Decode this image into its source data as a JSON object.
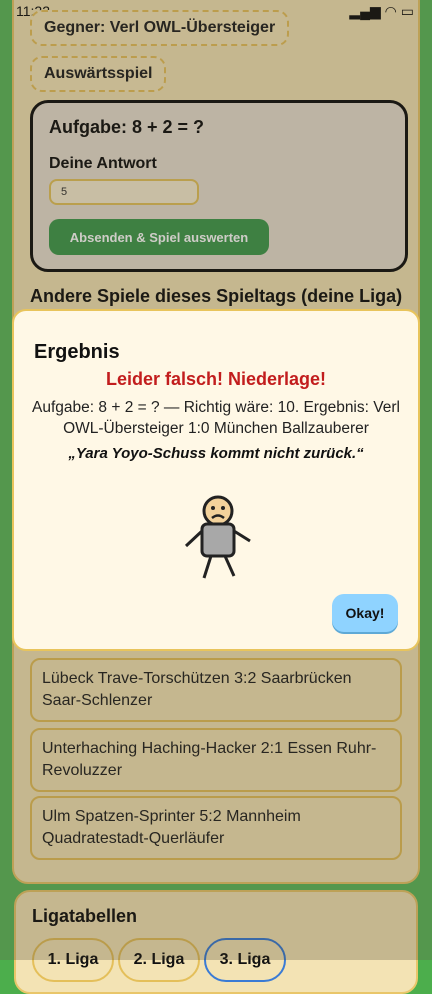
{
  "status_bar": {
    "time": "11:22"
  },
  "header": {
    "opponent": "Gegner: Verl OWL-Übersteiger",
    "match_type": "Auswärtsspiel"
  },
  "task_card": {
    "question": "Aufgabe: 8 + 2 = ?",
    "answer_label": "Deine Antwort",
    "answer_value": "5",
    "submit_label": "Absenden & Spiel auswerten"
  },
  "other_games": {
    "title": "Andere Spiele dieses Spieltags (deine Liga)",
    "items": [
      "Lübeck Trave-Torschützen 3:2 Saarbrücken Saar-Schlenzer",
      "Unterhaching Haching-Hacker 2:1 Essen Ruhr-Revoluzzer",
      "Ulm Spatzen-Sprinter 5:2 Mannheim Quadratestadt-Querläufer"
    ]
  },
  "league_tables": {
    "title": "Ligatabellen",
    "tabs": [
      "1. Liga",
      "2. Liga",
      "3. Liga"
    ]
  },
  "modal": {
    "title": "Ergebnis",
    "result": "Leider falsch! Niederlage!",
    "detail": "Aufgabe: 8 + 2 = ? — Richtig wäre: 10. Ergebnis: Verl OWL-Übersteiger 1:0 München Ballzauberer",
    "quote": "„Yara Yoyo-Schuss kommt nicht zurück.“",
    "ok_label": "Okay!"
  },
  "colors": {
    "result_red": "#c21d1d",
    "ok_button": "#8fd3ff",
    "submit_green": "#3f9a4e"
  }
}
